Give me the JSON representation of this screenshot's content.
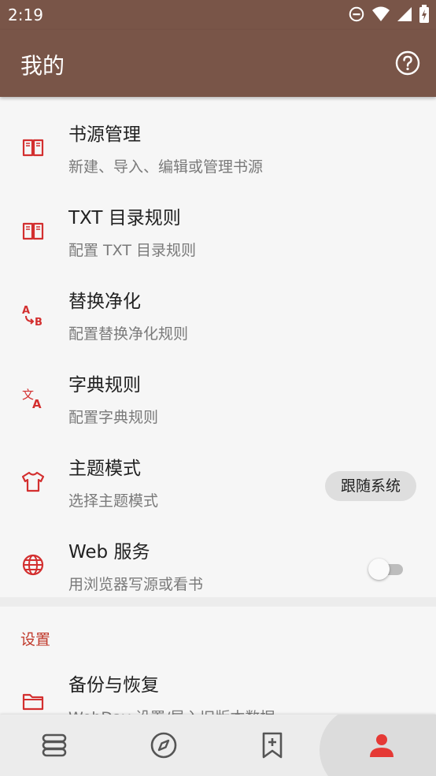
{
  "status_bar": {
    "time": "2:19"
  },
  "app_bar": {
    "title": "我的"
  },
  "items": [
    {
      "title": "书源管理",
      "subtitle": "新建、导入、编辑或管理书源",
      "icon": "book-open-icon"
    },
    {
      "title": "TXT 目录规则",
      "subtitle": "配置 TXT 目录规则",
      "icon": "book-open-icon"
    },
    {
      "title": "替换净化",
      "subtitle": "配置替换净化规则",
      "icon": "replace-ab-icon"
    },
    {
      "title": "字典规则",
      "subtitle": "配置字典规则",
      "icon": "translate-icon"
    },
    {
      "title": "主题模式",
      "subtitle": "选择主题模式",
      "icon": "tshirt-icon",
      "chip": "跟随系统"
    },
    {
      "title": "Web 服务",
      "subtitle": "用浏览器写源或看书",
      "icon": "globe-icon",
      "toggle_on": false
    }
  ],
  "settings": {
    "header": "设置",
    "backup": {
      "title": "备份与恢复",
      "subtitle": "WebDav 设置/导入旧版本数据",
      "icon": "folder-icon"
    }
  },
  "bottom_nav": [
    {
      "icon": "bookshelf-icon",
      "active": false
    },
    {
      "icon": "compass-icon",
      "active": false
    },
    {
      "icon": "bookmark-add-icon",
      "active": false
    },
    {
      "icon": "person-icon",
      "active": true
    }
  ],
  "colors": {
    "primary": "#795548",
    "accent": "#d32f2f",
    "background": "#f6f6f6"
  }
}
